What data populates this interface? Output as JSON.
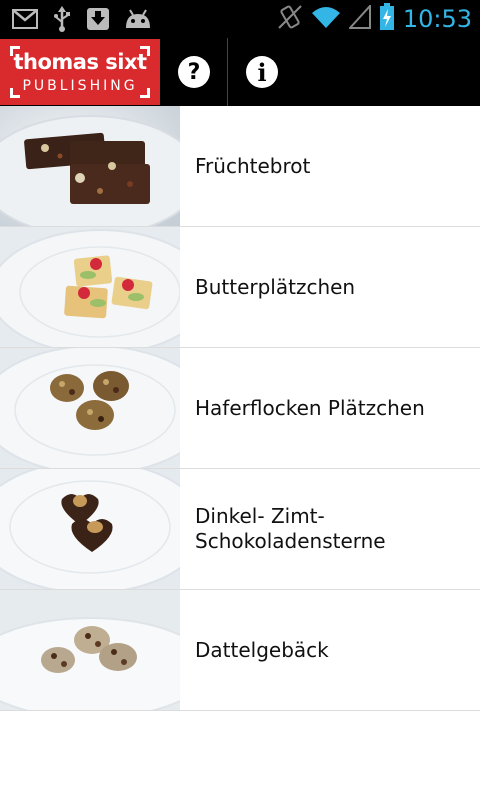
{
  "status_bar": {
    "left_icons": [
      "gmail-icon",
      "usb-icon",
      "download-icon",
      "android-debug-icon"
    ],
    "right_icons": [
      "vibrate-icon",
      "wifi-icon",
      "signal-icon",
      "battery-charging-icon"
    ],
    "time": "10:53",
    "time_color": "#33b5e5"
  },
  "action_bar": {
    "logo_line1": "thomas sixt",
    "logo_line2": "PUBLISHING",
    "logo_color": "#d92a2e",
    "help_icon": "?",
    "info_icon": "i"
  },
  "recipes": [
    {
      "title": "Früchtebrot",
      "image": "fruit-bread-photo"
    },
    {
      "title": "Butterplätzchen",
      "image": "butter-cookies-photo"
    },
    {
      "title": "Haferflocken Plätzchen",
      "image": "oat-cookies-photo"
    },
    {
      "title": "Dinkel- Zimt-\nSchokoladensterne",
      "image": "chocolate-hearts-photo"
    },
    {
      "title": "Dattelgebäck",
      "image": "date-pastry-photo"
    }
  ]
}
